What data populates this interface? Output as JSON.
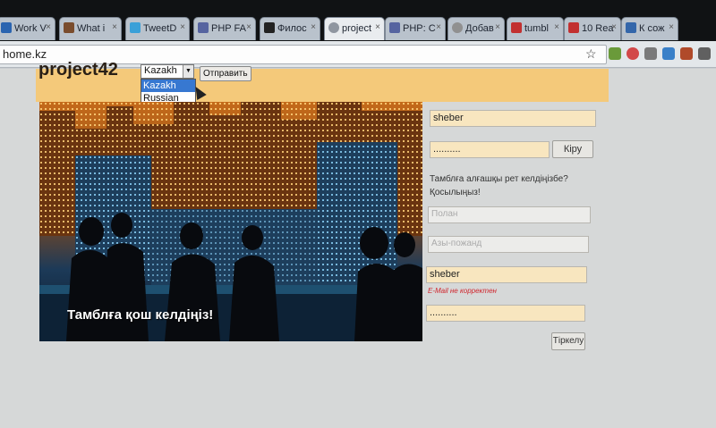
{
  "browser": {
    "tabs": [
      {
        "label": "Work V",
        "fav": "#2a64b0"
      },
      {
        "label": "What i",
        "fav": "#7a4d2e"
      },
      {
        "label": "TweetD",
        "fav": "#3aa0d8"
      },
      {
        "label": "PHP FA",
        "fav": "#5664a0"
      },
      {
        "label": "Филос",
        "fav": "#222222"
      },
      {
        "label": "project",
        "fav": "#8f96a0"
      },
      {
        "label": "PHP: C",
        "fav": "#5664a0"
      },
      {
        "label": "Добав",
        "fav": "#909090"
      },
      {
        "label": "tumbl",
        "fav": "#c23030"
      },
      {
        "label": "10 Rea",
        "fav": "#c23030"
      },
      {
        "label": "К сож",
        "fav": "#3366aa"
      }
    ],
    "close_glyph": "×",
    "url": "home.kz",
    "star_glyph": "☆"
  },
  "page": {
    "logo": "project42",
    "language_select": {
      "value": "Kazakh",
      "arrow": "▼",
      "options": [
        "Kazakh",
        "Russian"
      ]
    },
    "send_button": "Отправить",
    "hero_text": "Тамблға қош келдіңіз!",
    "login": {
      "username": "sheber",
      "password": "..........",
      "login_button": "Кіру"
    },
    "signup": {
      "prompt": "Тамблға алғашқы рет келдіңізбе? Қосылыңыз!",
      "name_placeholder": "Полан",
      "surname_placeholder": "Азы-пожанд",
      "email_value": "sheber",
      "email_error": "E-Mail не корректен",
      "password": "..........",
      "register_button": "Тіркелу"
    }
  },
  "colors": {
    "header": "#f4c97a",
    "field_filled": "#f8e6bf",
    "error": "#d0262e",
    "select_highlight": "#3778d1"
  }
}
